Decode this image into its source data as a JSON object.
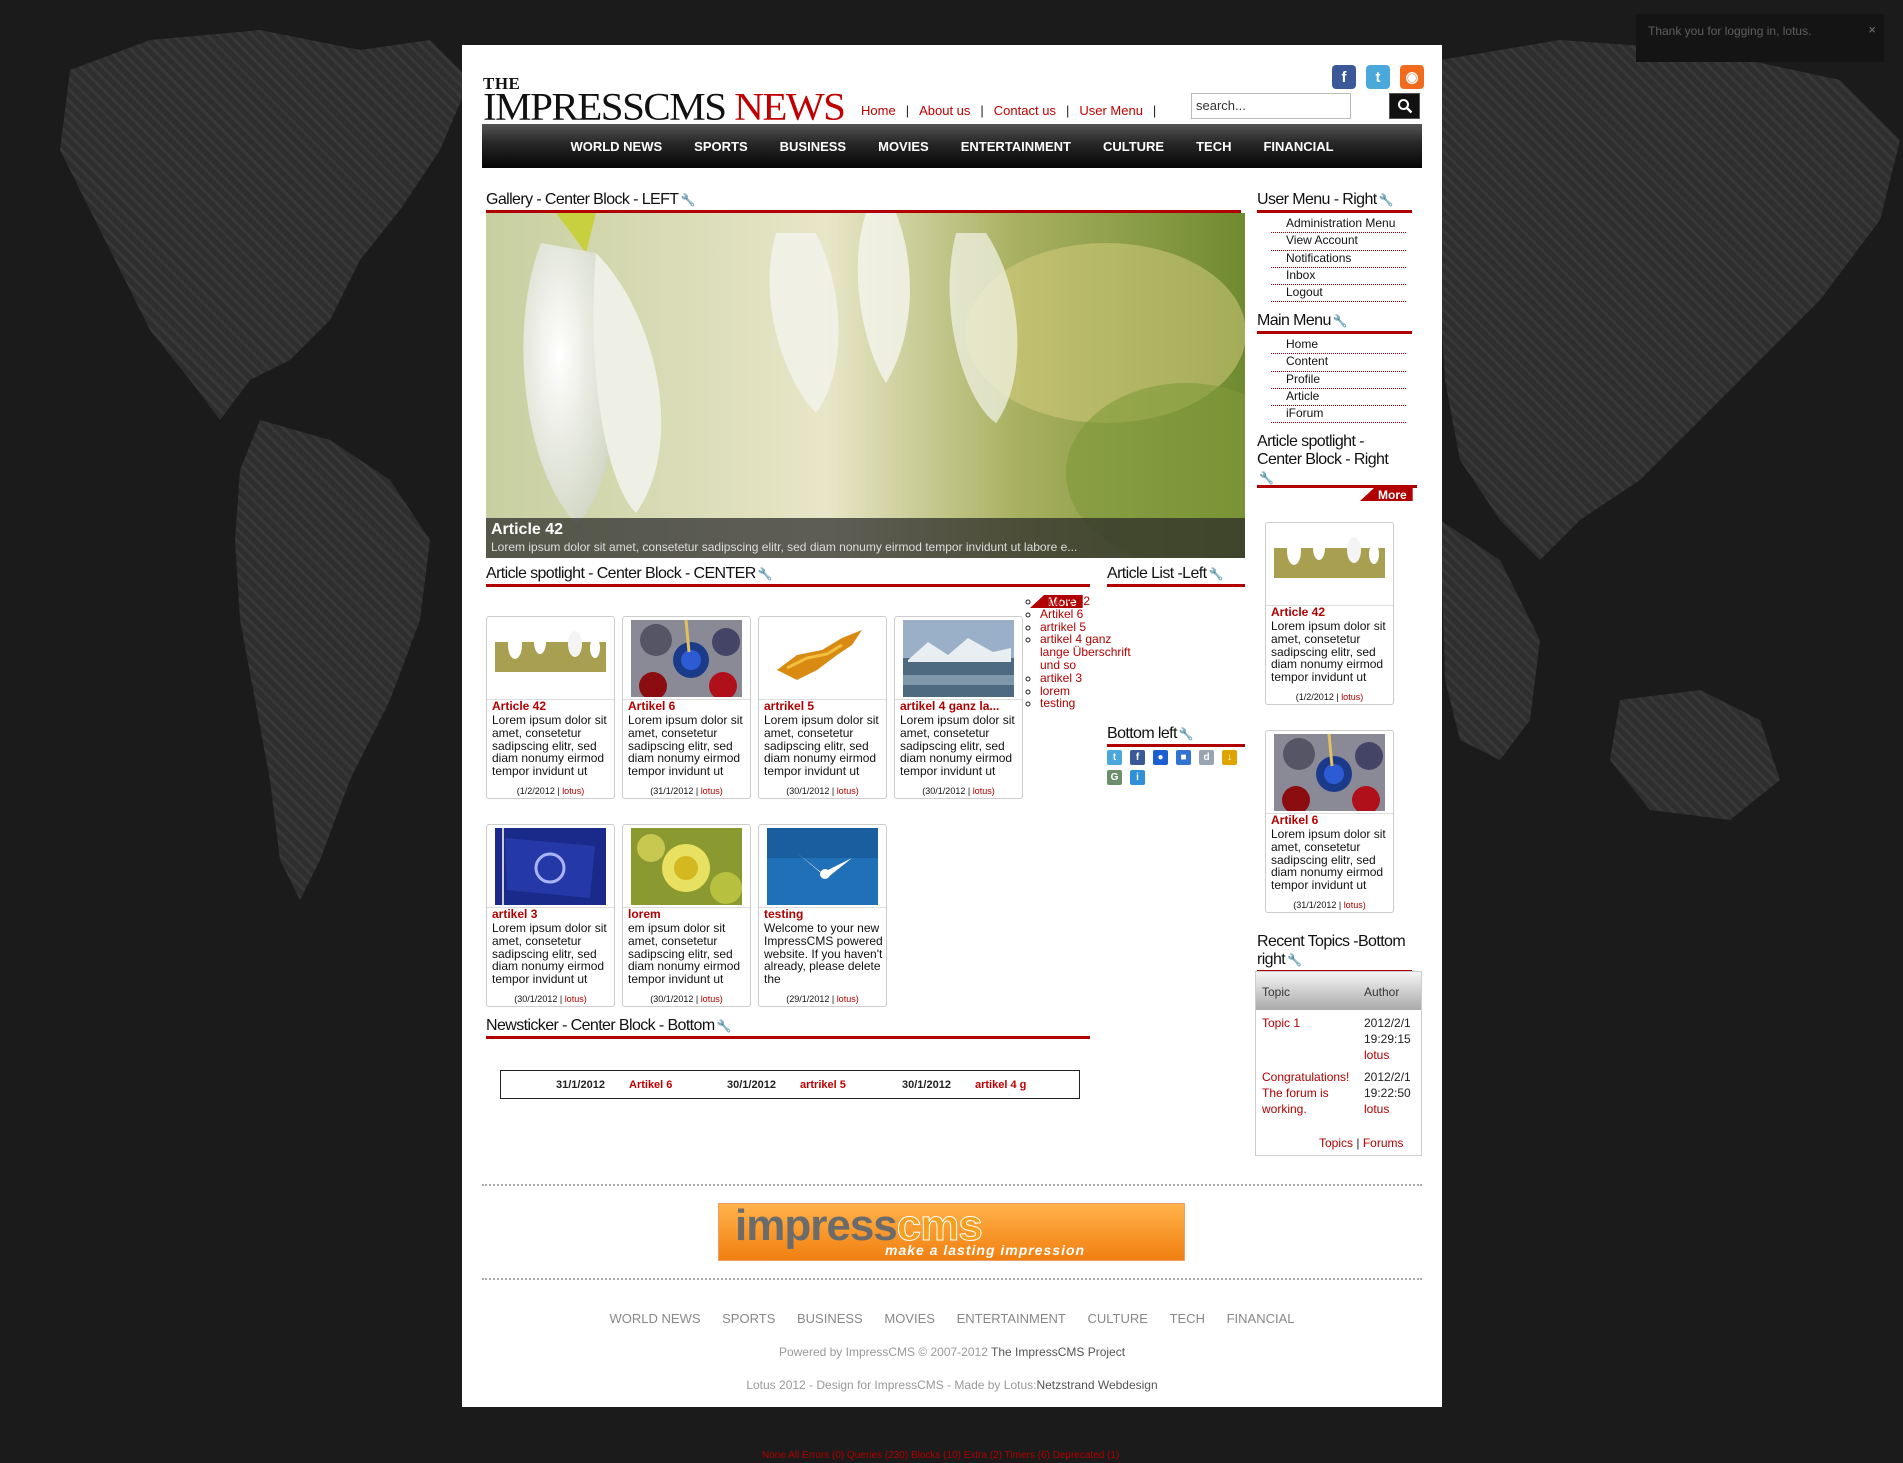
{
  "toast": {
    "message": "Thank you for logging in, lotus.",
    "close": "×"
  },
  "debug_bar": "None All Errors (0) Queries (230) Blocks (10) Extra (2) Timers (6) Deprecated (1)",
  "header": {
    "logo_the": "THE",
    "logo_main": "IMPRESSCMS",
    "logo_accent": "NEWS",
    "top_links": [
      "Home",
      "About us",
      "Contact us",
      "User Menu"
    ],
    "search_placeholder": "search...",
    "social": [
      {
        "name": "facebook-icon",
        "glyph": "f",
        "color": "#3b5998"
      },
      {
        "name": "twitter-icon",
        "glyph": "t",
        "color": "#4aa8db"
      },
      {
        "name": "rss-icon",
        "glyph": "◉",
        "color": "#f26a1b"
      }
    ]
  },
  "nav": [
    "WORLD NEWS",
    "SPORTS",
    "BUSINESS",
    "MOVIES",
    "ENTERTAINMENT",
    "CULTURE",
    "TECH",
    "FINANCIAL"
  ],
  "gallery": {
    "block_title": "Gallery - Center Block - LEFT",
    "caption_title": "Article 42",
    "caption_text": "Lorem ipsum dolor sit amet, consetetur sadipscing elitr, sed diam nonumy eirmod tempor invidunt ut labore e..."
  },
  "spotlight_center": {
    "block_title": "Article spotlight - Center Block - CENTER",
    "more": "More",
    "cards": [
      {
        "title": "Article 42",
        "body": "Lorem ipsum dolor sit amet, consetetur sadipscing elitr, sed diam nonumy eirmod tempor invidunt ut",
        "date": "(1/2/2012 |",
        "user": "lotus)"
      },
      {
        "title": "Artikel 6",
        "body": "Lorem ipsum dolor sit amet, consetetur sadipscing elitr, sed diam nonumy eirmod tempor invidunt ut",
        "date": "(31/1/2012 |",
        "user": "lotus)"
      },
      {
        "title": "artrikel 5",
        "body": "Lorem ipsum dolor sit amet, consetetur sadipscing elitr, sed diam nonumy eirmod tempor invidunt ut",
        "date": "(30/1/2012 |",
        "user": "lotus)"
      },
      {
        "title": "artikel 4 ganz la...",
        "body": "Lorem ipsum dolor sit amet, consetetur sadipscing elitr, sed diam nonumy eirmod tempor invidunt ut",
        "date": "(30/1/2012 |",
        "user": "lotus)"
      },
      {
        "title": "artikel 3",
        "body": "Lorem ipsum dolor sit amet, consetetur sadipscing elitr, sed diam nonumy eirmod tempor invidunt ut",
        "date": "(30/1/2012 |",
        "user": "lotus)"
      },
      {
        "title": "lorem",
        "body": "em ipsum dolor sit amet, consetetur sadipscing elitr, sed diam nonumy eirmod tempor invidunt ut",
        "date": "(30/1/2012 |",
        "user": "lotus)"
      },
      {
        "title": "testing",
        "body": "Welcome to your new ImpressCMS powered website. If you haven't already, please delete the",
        "date": "(29/1/2012 |",
        "user": "lotus)"
      }
    ]
  },
  "article_list": {
    "block_title": "Article List -Left",
    "items": [
      "Article 42",
      "Artikel 6",
      "artrikel 5",
      "artikel 4 ganz lange Überschrift und so",
      "artikel 3",
      "lorem",
      "testing"
    ]
  },
  "bottom_left": {
    "block_title": "Bottom left",
    "icons": [
      {
        "name": "twitter-share-icon",
        "glyph": "t",
        "color": "#4aa8db"
      },
      {
        "name": "facebook-share-icon",
        "glyph": "f",
        "color": "#3b5998"
      },
      {
        "name": "myspace-share-icon",
        "glyph": "●",
        "color": "#1b5fd0"
      },
      {
        "name": "delicious-share-icon",
        "glyph": "■",
        "color": "#3274d1"
      },
      {
        "name": "digg-share-icon",
        "glyph": "d",
        "color": "#9aa4b0"
      },
      {
        "name": "download-share-icon",
        "glyph": "↓",
        "color": "#e0a400"
      },
      {
        "name": "google-share-icon",
        "glyph": "G",
        "color": "#6a8f6a"
      },
      {
        "name": "hi5-share-icon",
        "glyph": "i",
        "color": "#2f8fd8"
      }
    ]
  },
  "newsticker": {
    "block_title": "Newsticker - Center Block - Bottom",
    "items": [
      {
        "date": "31/1/2012",
        "link": "Artikel 6"
      },
      {
        "date": "30/1/2012",
        "link": "artrikel 5"
      },
      {
        "date": "30/1/2012",
        "link": "artikel 4 g"
      }
    ]
  },
  "user_menu": {
    "block_title": "User Menu - Right",
    "items": [
      "Administration Menu",
      "View Account",
      "Notifications",
      "Inbox",
      "Logout"
    ]
  },
  "main_menu": {
    "block_title": "Main Menu",
    "items": [
      "Home",
      "Content",
      "Profile",
      "Article",
      "iForum"
    ]
  },
  "spotlight_right": {
    "block_title_line1": "Article spotlight -",
    "block_title_line2": "Center Block - Right",
    "more": "More",
    "cards": [
      {
        "title": "Article 42",
        "body": "Lorem ipsum dolor sit amet, consetetur sadipscing elitr, sed diam nonumy eirmod tempor invidunt ut",
        "date": "(1/2/2012 |",
        "user": "lotus)"
      },
      {
        "title": "Artikel 6",
        "body": "Lorem ipsum dolor sit amet, consetetur sadipscing elitr, sed diam nonumy eirmod tempor invidunt ut",
        "date": "(31/1/2012 |",
        "user": "lotus)"
      }
    ]
  },
  "recent_topics": {
    "block_title_line1": "Recent Topics -Bottom",
    "block_title_line2": "right",
    "col_topic": "Topic",
    "col_author": "Author",
    "rows": [
      {
        "topic": [
          "Topic 1"
        ],
        "date": "2012/2/1",
        "time": "19:29:15",
        "author": "lotus"
      },
      {
        "topic": [
          "Congratulations!",
          "The forum is",
          "working."
        ],
        "date": "2012/2/1",
        "time": "19:22:50",
        "author": "lotus"
      }
    ],
    "link_topics": "Topics",
    "link_forums": "Forums",
    "link_sep": "|"
  },
  "footer": {
    "banner_word1": "impress",
    "banner_word2": "cms",
    "banner_tagline": "make a lasting impression",
    "nav": [
      "WORLD NEWS",
      "SPORTS",
      "BUSINESS",
      "MOVIES",
      "ENTERTAINMENT",
      "CULTURE",
      "TECH",
      "FINANCIAL"
    ],
    "powered_prefix": "Powered by ImpressCMS © 2007-2012",
    "powered_link": "The ImpressCMS Project",
    "credit_prefix": "Lotus 2012 - Design for ImpressCMS - Made by Lotus:",
    "credit_link": "Netzstrand Webdesign"
  }
}
